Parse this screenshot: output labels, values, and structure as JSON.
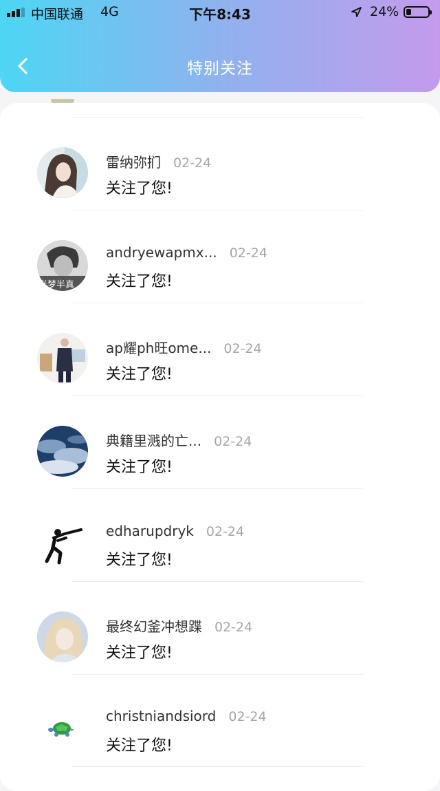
{
  "status_bar": {
    "carrier": "中国联通",
    "network": "4G",
    "time": "下午8:43",
    "battery": "24%",
    "battery_level": 0.24
  },
  "header": {
    "title": "特别关注",
    "back_icon": "chevron-left-icon"
  },
  "list": [
    {
      "name": "雷纳弥扪",
      "date": "02-24",
      "message": "关注了您!",
      "avatar": "woman-photo"
    },
    {
      "name": "andryewapmx...",
      "date": "02-24",
      "message": "关注了您!",
      "avatar": "man-bw-photo",
      "avatar_text": "半梦半真"
    },
    {
      "name": "ap耀ph旺ome...",
      "date": "02-24",
      "message": "关注了您!",
      "avatar": "businessman-photo"
    },
    {
      "name": "典籍里溅的亡...",
      "date": "02-24",
      "message": "关注了您!",
      "avatar": "sky-clouds-photo"
    },
    {
      "name": "edharupdryk",
      "date": "02-24",
      "message": "关注了您!",
      "avatar": "shooting-pictogram"
    },
    {
      "name": "最终幻釜冲想蹀",
      "date": "02-24",
      "message": "关注了您!",
      "avatar": "blonde-girl-photo"
    },
    {
      "name": "christniandsiord",
      "date": "02-24",
      "message": "关注了您!",
      "avatar": "turtle-icon"
    }
  ]
}
